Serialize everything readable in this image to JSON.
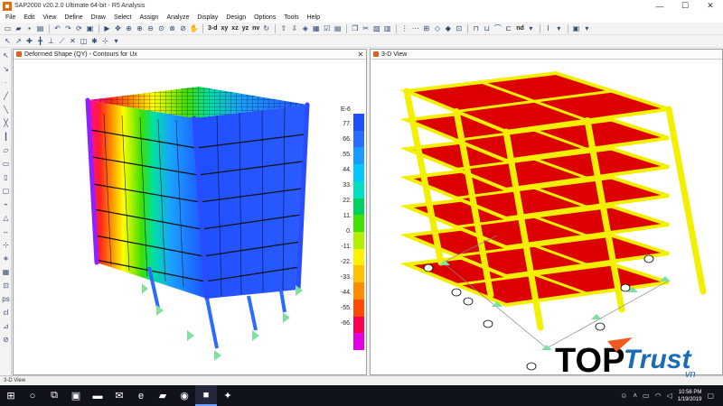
{
  "window": {
    "title": "SAP2000 v20.2.0 Ultimate 64-bit - R5 Analysis",
    "minimize": "—",
    "maximize": "☐",
    "close": "✕"
  },
  "menu": [
    "File",
    "Edit",
    "View",
    "Define",
    "Draw",
    "Select",
    "Assign",
    "Analyze",
    "Display",
    "Design",
    "Options",
    "Tools",
    "Help"
  ],
  "toolbar": {
    "view_3d": "3-d",
    "view_xy": "xy",
    "view_xz": "xz",
    "view_yz": "yz",
    "view_nv": "nv",
    "nd": "nd"
  },
  "panels": {
    "left": {
      "title": "Deformed Shape (QY) - Contours for Ux"
    },
    "right": {
      "title": "3-D View"
    }
  },
  "legend": {
    "unit": "E-6",
    "values": [
      "77.",
      "66.",
      "55.",
      "44.",
      "33.",
      "22.",
      "11.",
      "0.",
      "-11.",
      "-22.",
      "-33.",
      "-44.",
      "-55.",
      "-66."
    ],
    "colors": [
      "#1f4fff",
      "#2a6cff",
      "#1a9cff",
      "#00c8ff",
      "#00e0c0",
      "#00d060",
      "#40e000",
      "#b0f000",
      "#fff000",
      "#ffc000",
      "#ff8c00",
      "#ff4a00",
      "#ff0050",
      "#e000e0"
    ]
  },
  "status": {
    "text": "3-D View"
  },
  "taskbar": {
    "time": "10:56 PM",
    "date": "1/19/2019"
  },
  "logo": {
    "word1": "TOP",
    "word2": "Trust",
    "suffix": "vn"
  },
  "colors": {
    "column_yellow": "#f2f000",
    "slab_red": "#dd0000",
    "brand_orange": "#f15a22",
    "brand_blue": "#1b6db5"
  }
}
